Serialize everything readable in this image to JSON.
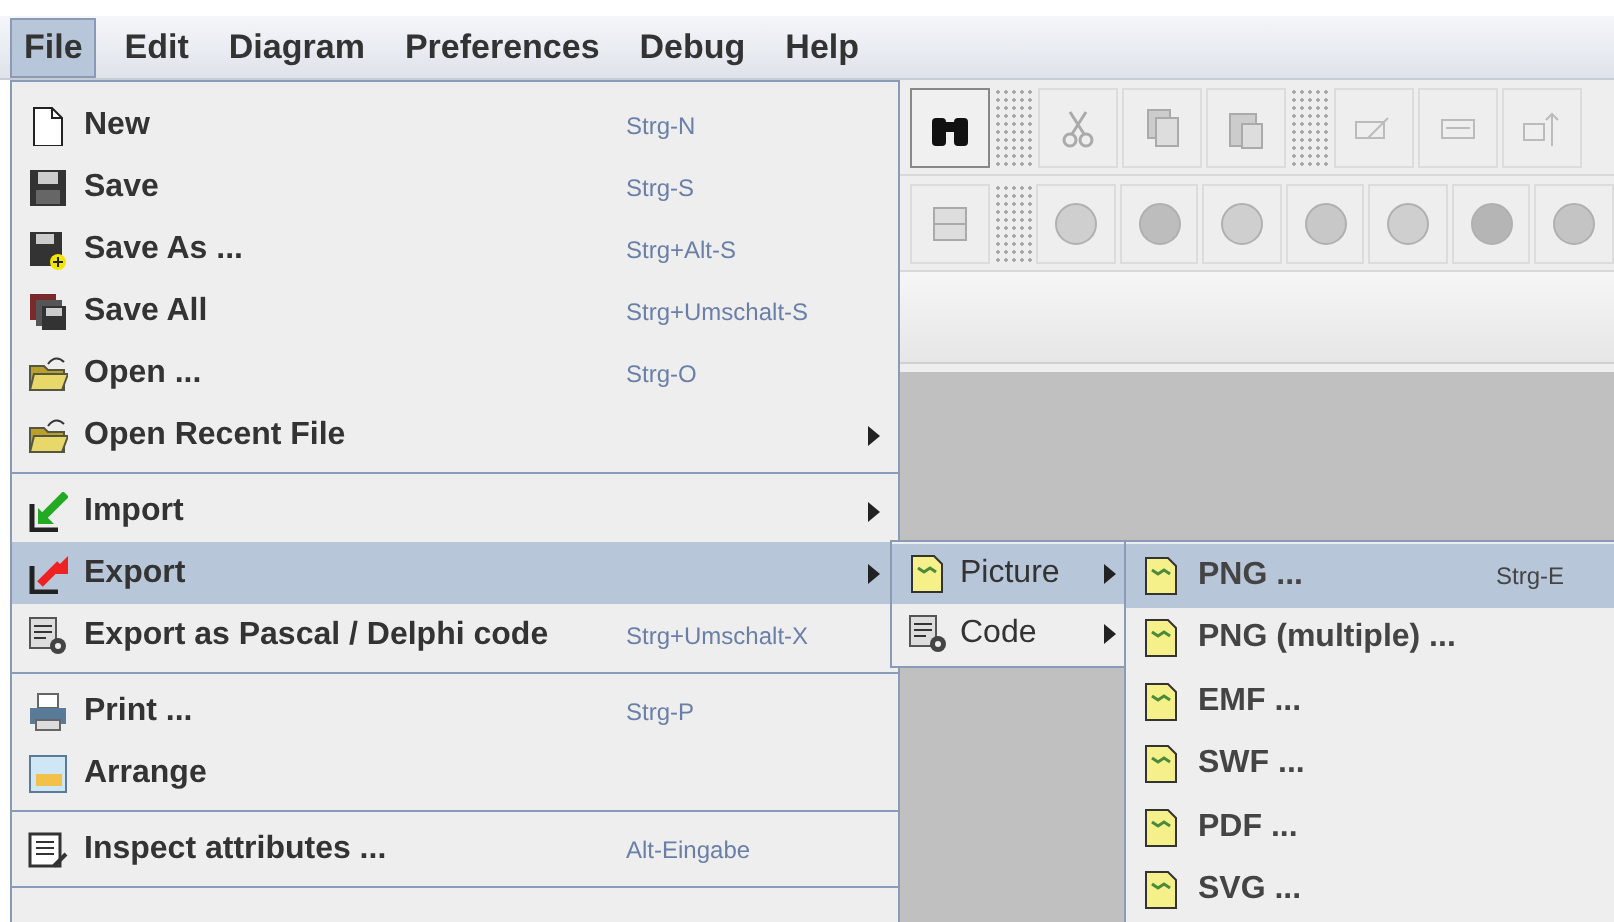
{
  "menu_bar": [
    {
      "label": "File",
      "selected": true
    },
    {
      "label": "Edit",
      "selected": false
    },
    {
      "label": "Diagram",
      "selected": false
    },
    {
      "label": "Preferences",
      "selected": false
    },
    {
      "label": "Debug",
      "selected": false
    },
    {
      "label": "Help",
      "selected": false
    }
  ],
  "file_menu": [
    {
      "kind": "item",
      "label": "New",
      "shortcut": "Strg-N",
      "selected": false
    },
    {
      "kind": "item",
      "label": "Save",
      "shortcut": "Strg-S",
      "selected": false
    },
    {
      "kind": "item",
      "label": "Save As ...",
      "shortcut": "Strg+Alt-S",
      "selected": false
    },
    {
      "kind": "item",
      "label": "Save All",
      "shortcut": "Strg+Umschalt-S",
      "selected": false
    },
    {
      "kind": "item",
      "label": "Open ...",
      "shortcut": "Strg-O",
      "selected": false
    },
    {
      "kind": "submenu",
      "label": "Open Recent File",
      "selected": false
    },
    {
      "kind": "separator"
    },
    {
      "kind": "submenu",
      "label": "Import",
      "selected": false
    },
    {
      "kind": "submenu",
      "label": "Export",
      "selected": true
    },
    {
      "kind": "item",
      "label": "Export as Pascal / Delphi code",
      "shortcut": "Strg+Umschalt-X",
      "selected": false
    },
    {
      "kind": "separator"
    },
    {
      "kind": "item",
      "label": "Print ...",
      "shortcut": "Strg-P",
      "selected": false
    },
    {
      "kind": "item",
      "label": "Arrange",
      "selected": false
    },
    {
      "kind": "separator"
    },
    {
      "kind": "item",
      "label": "Inspect attributes ...",
      "shortcut": "Alt-Eingabe",
      "selected": false
    },
    {
      "kind": "separator"
    }
  ],
  "export_submenu": [
    {
      "label": "Picture",
      "selected": true
    },
    {
      "label": "Code",
      "selected": false
    }
  ],
  "picture_submenu": [
    {
      "label": "PNG ...",
      "shortcut": "Strg-E",
      "selected": true
    },
    {
      "label": "PNG (multiple) ...",
      "selected": false
    },
    {
      "label": "EMF ...",
      "selected": false
    },
    {
      "label": "SWF ...",
      "selected": false
    },
    {
      "label": "PDF ...",
      "selected": false
    },
    {
      "label": "SVG ...",
      "selected": false
    }
  ]
}
